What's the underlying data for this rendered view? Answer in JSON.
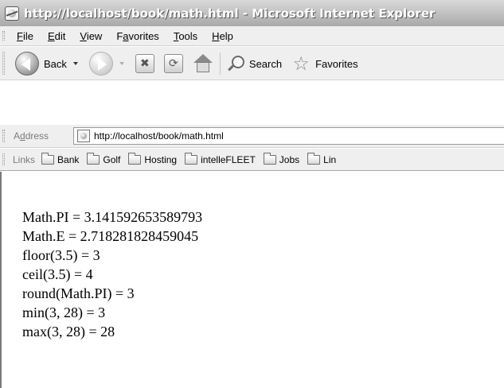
{
  "window": {
    "title": "http://localhost/book/math.html - Microsoft Internet Explorer"
  },
  "menu": {
    "items": [
      {
        "key": "F",
        "rest": "ile"
      },
      {
        "key": "E",
        "rest": "dit"
      },
      {
        "key": "V",
        "rest": "iew"
      },
      {
        "pre": "F",
        "key": "a",
        "rest": "vorites"
      },
      {
        "key": "T",
        "rest": "ools"
      },
      {
        "key": "H",
        "rest": "elp"
      }
    ]
  },
  "toolbar": {
    "back_label": "Back",
    "search_label": "Search",
    "favorites_label": "Favorites"
  },
  "address": {
    "label_pre": "A",
    "label_key": "d",
    "label_rest": "dress",
    "url": "http://localhost/book/math.html"
  },
  "links": {
    "label": "Links",
    "items": [
      "Bank",
      "Golf",
      "Hosting",
      "intelleFLEET",
      "Jobs",
      "Lin"
    ]
  },
  "content": {
    "lines": [
      "Math.PI = 3.141592653589793",
      "Math.E = 2.718281828459045",
      "floor(3.5) = 3",
      "ceil(3.5) = 4",
      "round(Math.PI) = 3",
      "min(3, 28) = 3",
      "max(3, 28) = 28"
    ]
  }
}
